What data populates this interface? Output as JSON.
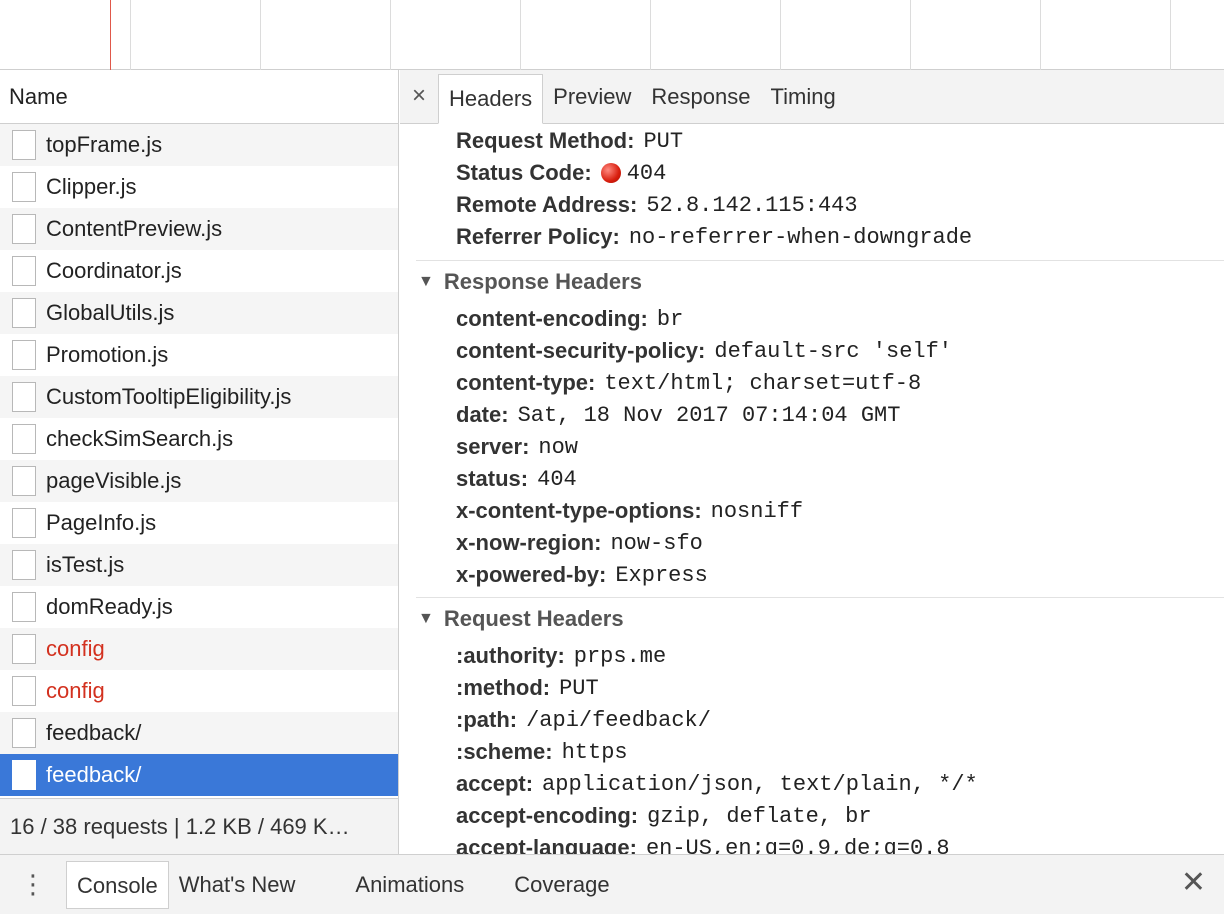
{
  "request_list": {
    "header": "Name",
    "items": [
      {
        "name": "topFrame.js",
        "error": false
      },
      {
        "name": "Clipper.js",
        "error": false
      },
      {
        "name": "ContentPreview.js",
        "error": false
      },
      {
        "name": "Coordinator.js",
        "error": false
      },
      {
        "name": "GlobalUtils.js",
        "error": false
      },
      {
        "name": "Promotion.js",
        "error": false
      },
      {
        "name": "CustomTooltipEligibility.js",
        "error": false
      },
      {
        "name": "checkSimSearch.js",
        "error": false
      },
      {
        "name": "pageVisible.js",
        "error": false
      },
      {
        "name": "PageInfo.js",
        "error": false
      },
      {
        "name": "isTest.js",
        "error": false
      },
      {
        "name": "domReady.js",
        "error": false
      },
      {
        "name": "config",
        "error": true
      },
      {
        "name": "config",
        "error": true
      },
      {
        "name": "feedback/",
        "error": false
      },
      {
        "name": "feedback/",
        "error": false,
        "selected": true
      }
    ],
    "status": "16 / 38 requests | 1.2 KB / 469 K…"
  },
  "detail_tabs": {
    "close": "×",
    "tabs": [
      "Headers",
      "Preview",
      "Response",
      "Timing"
    ],
    "active": "Headers"
  },
  "general": [
    {
      "key": "Request Method:",
      "value": "PUT"
    },
    {
      "key": "Status Code:",
      "value": "404",
      "status_dot": true
    },
    {
      "key": "Remote Address:",
      "value": "52.8.142.115:443"
    },
    {
      "key": "Referrer Policy:",
      "value": "no-referrer-when-downgrade"
    }
  ],
  "response_headers": {
    "title": "Response Headers",
    "items": [
      {
        "key": "content-encoding:",
        "value": "br"
      },
      {
        "key": "content-security-policy:",
        "value": "default-src 'self'"
      },
      {
        "key": "content-type:",
        "value": "text/html; charset=utf-8"
      },
      {
        "key": "date:",
        "value": "Sat, 18 Nov 2017 07:14:04 GMT"
      },
      {
        "key": "server:",
        "value": "now"
      },
      {
        "key": "status:",
        "value": "404"
      },
      {
        "key": "x-content-type-options:",
        "value": "nosniff"
      },
      {
        "key": "x-now-region:",
        "value": "now-sfo"
      },
      {
        "key": "x-powered-by:",
        "value": "Express"
      }
    ]
  },
  "request_headers": {
    "title": "Request Headers",
    "items": [
      {
        "key": ":authority:",
        "value": "prps.me"
      },
      {
        "key": ":method:",
        "value": "PUT"
      },
      {
        "key": ":path:",
        "value": "/api/feedback/"
      },
      {
        "key": ":scheme:",
        "value": "https"
      },
      {
        "key": "accept:",
        "value": "application/json, text/plain, */*"
      },
      {
        "key": "accept-encoding:",
        "value": "gzip, deflate, br"
      },
      {
        "key": "accept-language:",
        "value": "en-US,en;q=0.9,de;q=0.8"
      }
    ]
  },
  "drawer": {
    "menu_icon": "⋮",
    "tabs": [
      "Console",
      "What's New",
      "Animations",
      "Coverage"
    ],
    "active": "Console",
    "close": "✕"
  },
  "colors": {
    "selected_row": "#3a78d8",
    "error_text": "#d3311f",
    "timeline_marker": "#e0584a"
  }
}
